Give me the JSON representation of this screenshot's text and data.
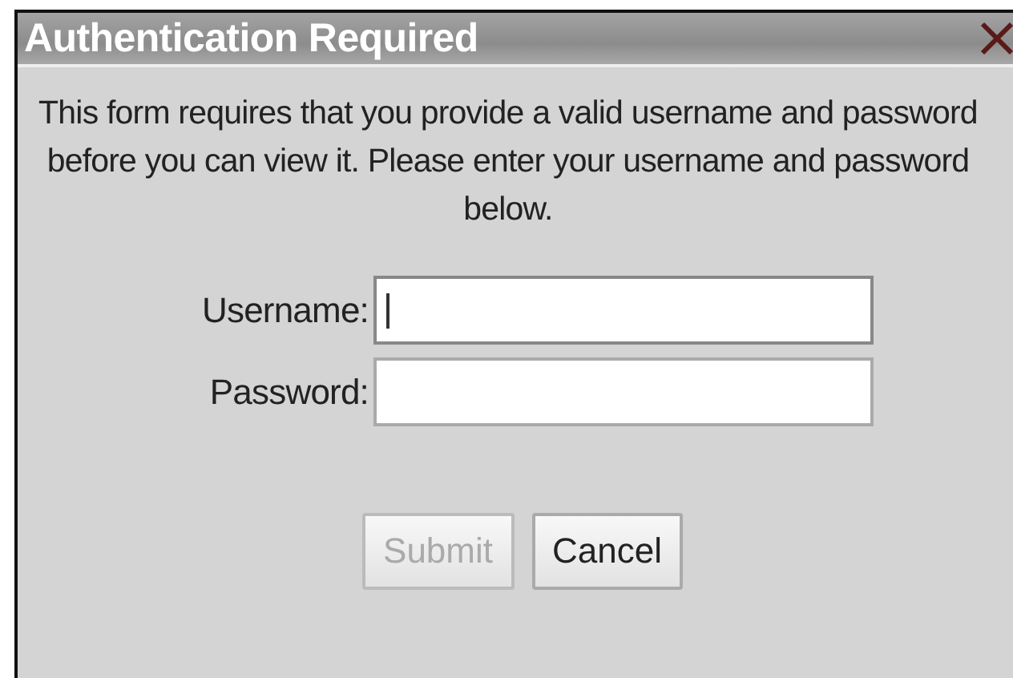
{
  "dialog": {
    "title": "Authentication Required",
    "message": "This form requires that you provide a valid username and password before you can view it. Please enter your username and password below.",
    "fields": [
      {
        "label": "Username:",
        "focused": true
      },
      {
        "label": "Password:",
        "focused": false
      }
    ],
    "buttons": [
      {
        "label": "Submit",
        "disabled": true
      },
      {
        "label": "Cancel",
        "disabled": false
      }
    ]
  }
}
